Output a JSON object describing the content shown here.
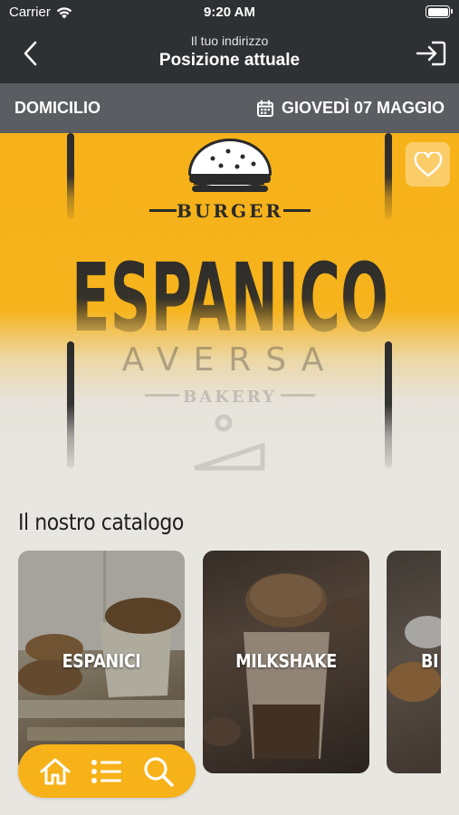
{
  "status_bar": {
    "carrier": "Carrier",
    "time": "9:20 AM"
  },
  "header": {
    "subtitle": "Il tuo indirizzo",
    "title": "Posizione attuale",
    "back_icon": "chevron-left-icon",
    "login_icon": "sign-in-icon"
  },
  "sub_bar": {
    "mode": "DOMICILIO",
    "date": "GIOVEDÌ 07 MAGGIO",
    "calendar_icon": "calendar-icon"
  },
  "banner": {
    "logo": {
      "top": "BURGER",
      "name": "ESPANICO",
      "city": "AVERSA",
      "bottom": "BAKERY"
    },
    "favorite_icon": "heart-icon"
  },
  "catalog": {
    "title": "Il nostro catalogo",
    "items": [
      {
        "label": "ESPANICI"
      },
      {
        "label": "MILKSHAKE"
      },
      {
        "label": "BI"
      }
    ]
  },
  "tab_bar": {
    "items": [
      "home-icon",
      "list-icon",
      "search-icon"
    ]
  },
  "colors": {
    "header_bg": "#2f3033",
    "sub_bar_bg": "#5b5d62",
    "accent": "#f7b219",
    "page_bg": "#e8e6e1"
  }
}
